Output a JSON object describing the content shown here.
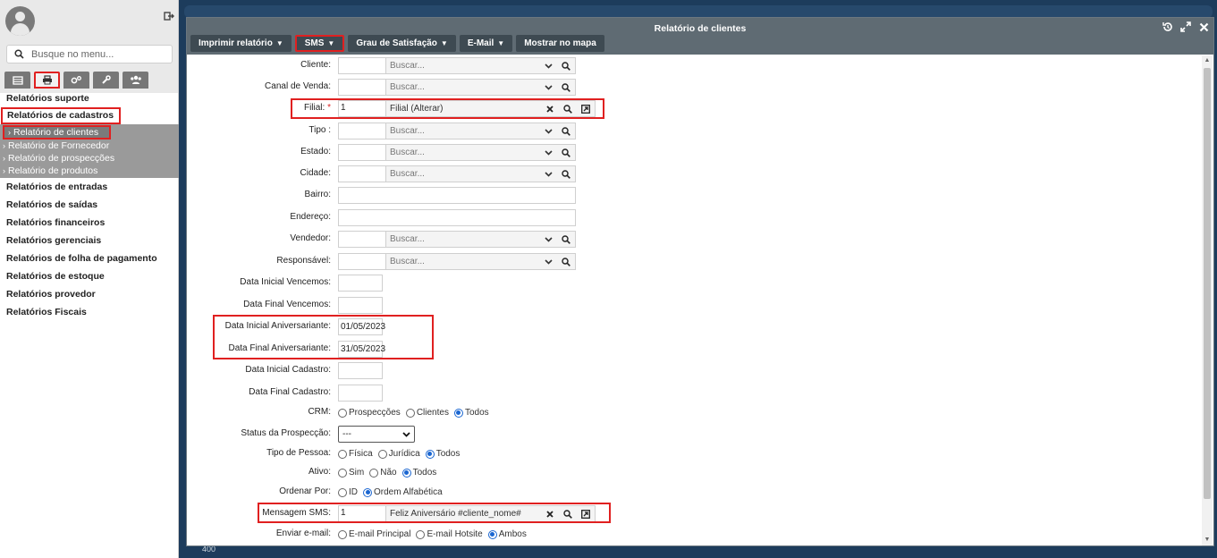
{
  "sidebar": {
    "search_placeholder": "Busque no menu...",
    "menu": [
      "Relatórios suporte",
      "Relatórios de cadastros",
      "Relatórios de entradas",
      "Relatórios de saídas",
      "Relatórios financeiros",
      "Relatórios gerenciais",
      "Relatórios de folha de pagamento",
      "Relatórios de estoque",
      "Relatórios provedor",
      "Relatórios Fiscais"
    ],
    "submenu": [
      "Relatório de clientes",
      "Relatório de Fornecedor",
      "Relatório de prospecções",
      "Relatório de produtos"
    ]
  },
  "background": {
    "axis_label": "400"
  },
  "modal": {
    "title": "Relatório de clientes",
    "toolbar": {
      "print": "Imprimir relatório",
      "sms": "SMS",
      "satisfaction": "Grau de Satisfação",
      "email": "E-Mail",
      "map": "Mostrar no mapa"
    },
    "fields": {
      "cliente": {
        "label": "Cliente:",
        "placeholder": "Buscar..."
      },
      "canal": {
        "label": "Canal de Venda:",
        "placeholder": "Buscar..."
      },
      "filial": {
        "label": "Filial:",
        "required": "*",
        "code": "1",
        "desc": "Filial (Alterar)"
      },
      "tipo": {
        "label": "Tipo :",
        "placeholder": "Buscar..."
      },
      "estado": {
        "label": "Estado:",
        "placeholder": "Buscar..."
      },
      "cidade": {
        "label": "Cidade:",
        "placeholder": "Buscar..."
      },
      "bairro": {
        "label": "Bairro:"
      },
      "endereco": {
        "label": "Endereço:"
      },
      "vendedor": {
        "label": "Vendedor:",
        "placeholder": "Buscar..."
      },
      "responsavel": {
        "label": "Responsável:",
        "placeholder": "Buscar..."
      },
      "data_ini_venc": {
        "label": "Data Inicial Vencemos:"
      },
      "data_fim_venc": {
        "label": "Data Final Vencemos:"
      },
      "data_ini_aniv": {
        "label": "Data Inicial Aniversariante:",
        "value": "01/05/2023"
      },
      "data_fim_aniv": {
        "label": "Data Final Aniversariante:",
        "value": "31/05/2023"
      },
      "data_ini_cad": {
        "label": "Data Inicial Cadastro:"
      },
      "data_fim_cad": {
        "label": "Data Final Cadastro:"
      },
      "crm": {
        "label": "CRM:",
        "options": [
          "Prospecções",
          "Clientes",
          "Todos"
        ],
        "selected": "Todos"
      },
      "status_prosp": {
        "label": "Status da Prospecção:",
        "value": "---"
      },
      "tipo_pessoa": {
        "label": "Tipo de Pessoa:",
        "options": [
          "Física",
          "Jurídica",
          "Todos"
        ],
        "selected": "Todos"
      },
      "ativo": {
        "label": "Ativo:",
        "options": [
          "Sim",
          "Não",
          "Todos"
        ],
        "selected": "Todos"
      },
      "ordenar": {
        "label": "Ordenar Por:",
        "options": [
          "ID",
          "Ordem Alfabética"
        ],
        "selected": "Ordem Alfabética"
      },
      "mensagem_sms": {
        "label": "Mensagem SMS:",
        "code": "1",
        "desc": "Feliz Aniversário #cliente_nome#"
      },
      "enviar_email": {
        "label": "Enviar e-mail:",
        "options": [
          "E-mail Principal",
          "E-mail Hotsite",
          "Ambos"
        ],
        "selected": "Ambos"
      }
    }
  },
  "colors": {
    "highlight": "#e02020",
    "header": "#5f6b73",
    "button": "#3e4a52",
    "radio": "#1a66d1"
  }
}
